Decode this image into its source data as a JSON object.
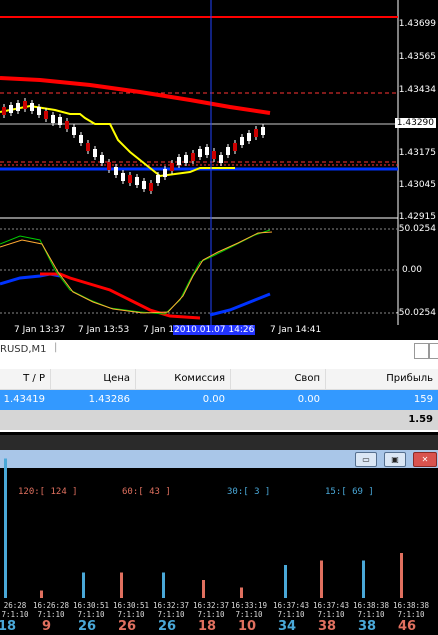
{
  "chart": {
    "price_labels": [
      "1.43699",
      "1.43565",
      "1.43434",
      "1.43290",
      "1.43175",
      "1.43045",
      "1.42915"
    ],
    "current_price": "1.43290",
    "osc_labels": [
      "50.0254",
      "0.00",
      "-50.0254"
    ],
    "time_labels": [
      "7 Jan 13:37",
      "7 Jan 13:53",
      "7 Jan 1",
      "7 Jan 14:41"
    ],
    "crosshair_time": "2010.01.07 14:26",
    "colors": {
      "bg": "#000000",
      "red": "#ff0000",
      "blue": "#0033ff",
      "yellow": "#ffff00",
      "green": "#00cc00",
      "crosshair": "#2244ff"
    }
  },
  "tab": {
    "symbol": "RUSD,M1"
  },
  "table": {
    "headers": [
      "T / P",
      "Цена",
      "Комиссия",
      "Своп",
      "Прибыль"
    ],
    "row": {
      "tp": "1.43419",
      "price": "1.43286",
      "commission": "0.00",
      "swap": "0.00",
      "profit": "159"
    },
    "total": "1.59"
  },
  "window_buttons": {
    "minimize": "▭",
    "restore": "▣",
    "close": "✕"
  },
  "histogram": {
    "top_counters": [
      {
        "label": "120:[ 124 ]",
        "color": "#e0705f"
      },
      {
        "label": "60:[ 43 ]",
        "color": "#e0705f"
      },
      {
        "label": "30:[ 3 ]",
        "color": "#4aa8d8"
      },
      {
        "label": "15:[ 69 ]",
        "color": "#4aa8d8"
      }
    ],
    "stamps": [
      {
        "time": "26:28",
        "sub": "7:1:10"
      },
      {
        "time": "16:26:28",
        "sub": "7:1:10"
      },
      {
        "time": "16:30:51",
        "sub": "7:1:10"
      },
      {
        "time": "16:30:51",
        "sub": "7:1:10"
      },
      {
        "time": "16:32:37",
        "sub": "7:1:10"
      },
      {
        "time": "16:32:37",
        "sub": "7:1:10"
      },
      {
        "time": "16:33:19",
        "sub": "7:1:10"
      },
      {
        "time": "16:37:43",
        "sub": "7:1:10"
      },
      {
        "time": "16:37:43",
        "sub": "7:1:10"
      },
      {
        "time": "16:38:38",
        "sub": "7:1:10"
      },
      {
        "time": "16:38:38",
        "sub": "7:1:10"
      }
    ],
    "counts": [
      {
        "value": "18",
        "color": "#4aa8d8"
      },
      {
        "value": "9",
        "color": "#e0705f"
      },
      {
        "value": "26",
        "color": "#4aa8d8"
      },
      {
        "value": "26",
        "color": "#e0705f"
      },
      {
        "value": "26",
        "color": "#4aa8d8"
      },
      {
        "value": "18",
        "color": "#e0705f"
      },
      {
        "value": "10",
        "color": "#e0705f"
      },
      {
        "value": "34",
        "color": "#4aa8d8"
      },
      {
        "value": "38",
        "color": "#e0705f"
      },
      {
        "value": "38",
        "color": "#4aa8d8"
      },
      {
        "value": "46",
        "color": "#e0705f"
      }
    ],
    "bars": [
      {
        "color": "#4aa8d8",
        "level": 0.93
      },
      {
        "color": "#e0705f",
        "level": 0.05
      },
      {
        "color": "#4aa8d8",
        "level": 0.17
      },
      {
        "color": "#e0705f",
        "level": 0.17
      },
      {
        "color": "#4aa8d8",
        "level": 0.17
      },
      {
        "color": "#e0705f",
        "level": 0.12
      },
      {
        "color": "#e0705f",
        "level": 0.07
      },
      {
        "color": "#4aa8d8",
        "level": 0.22
      },
      {
        "color": "#e0705f",
        "level": 0.25
      },
      {
        "color": "#4aa8d8",
        "level": 0.25
      },
      {
        "color": "#e0705f",
        "level": 0.3
      }
    ]
  }
}
